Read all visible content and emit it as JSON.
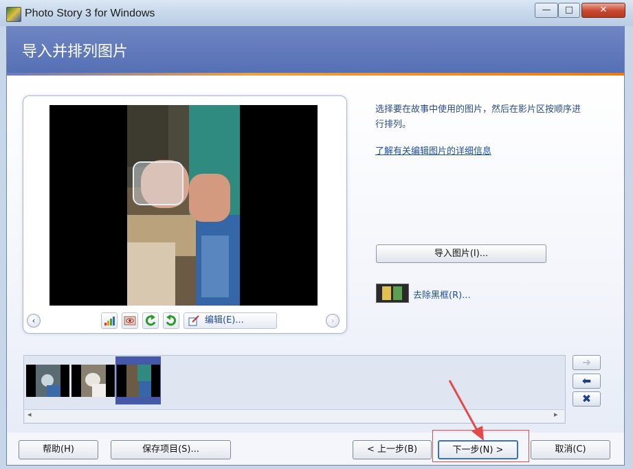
{
  "window": {
    "title": "Photo Story 3 for Windows",
    "minimize": "—",
    "maximize": "□",
    "close": "✕"
  },
  "page": {
    "title": "导入并排列图片"
  },
  "preview": {
    "prev_arrow": "‹",
    "next_arrow": "›",
    "tools": [
      {
        "name": "levels-icon"
      },
      {
        "name": "red-eye-icon"
      },
      {
        "name": "rotate-left-icon"
      },
      {
        "name": "rotate-right-icon"
      }
    ],
    "edit_label": "编辑(E)..."
  },
  "side": {
    "instructions": "选择要在故事中使用的图片，然后在影片区按顺序进行排列。",
    "help_link": "了解有关编辑图片的详细信息",
    "import_button": "导入图片(I)...",
    "remove_black_borders": "去除黑框(R)..."
  },
  "filmstrip": {
    "scroll_left": "◂",
    "scroll_right": "▸",
    "selected_index": 3,
    "buttons": {
      "move_right": "➜",
      "move_left": "⬅",
      "delete": "✖"
    }
  },
  "footer": {
    "help": "帮助(H)",
    "save": "保存项目(S)...",
    "back": "< 上一步(B)",
    "next": "下一步(N) >",
    "cancel": "取消(C)"
  },
  "colors": {
    "header": "#5f78bb",
    "accent": "#f07a10",
    "annotation": "#e34a4a"
  }
}
